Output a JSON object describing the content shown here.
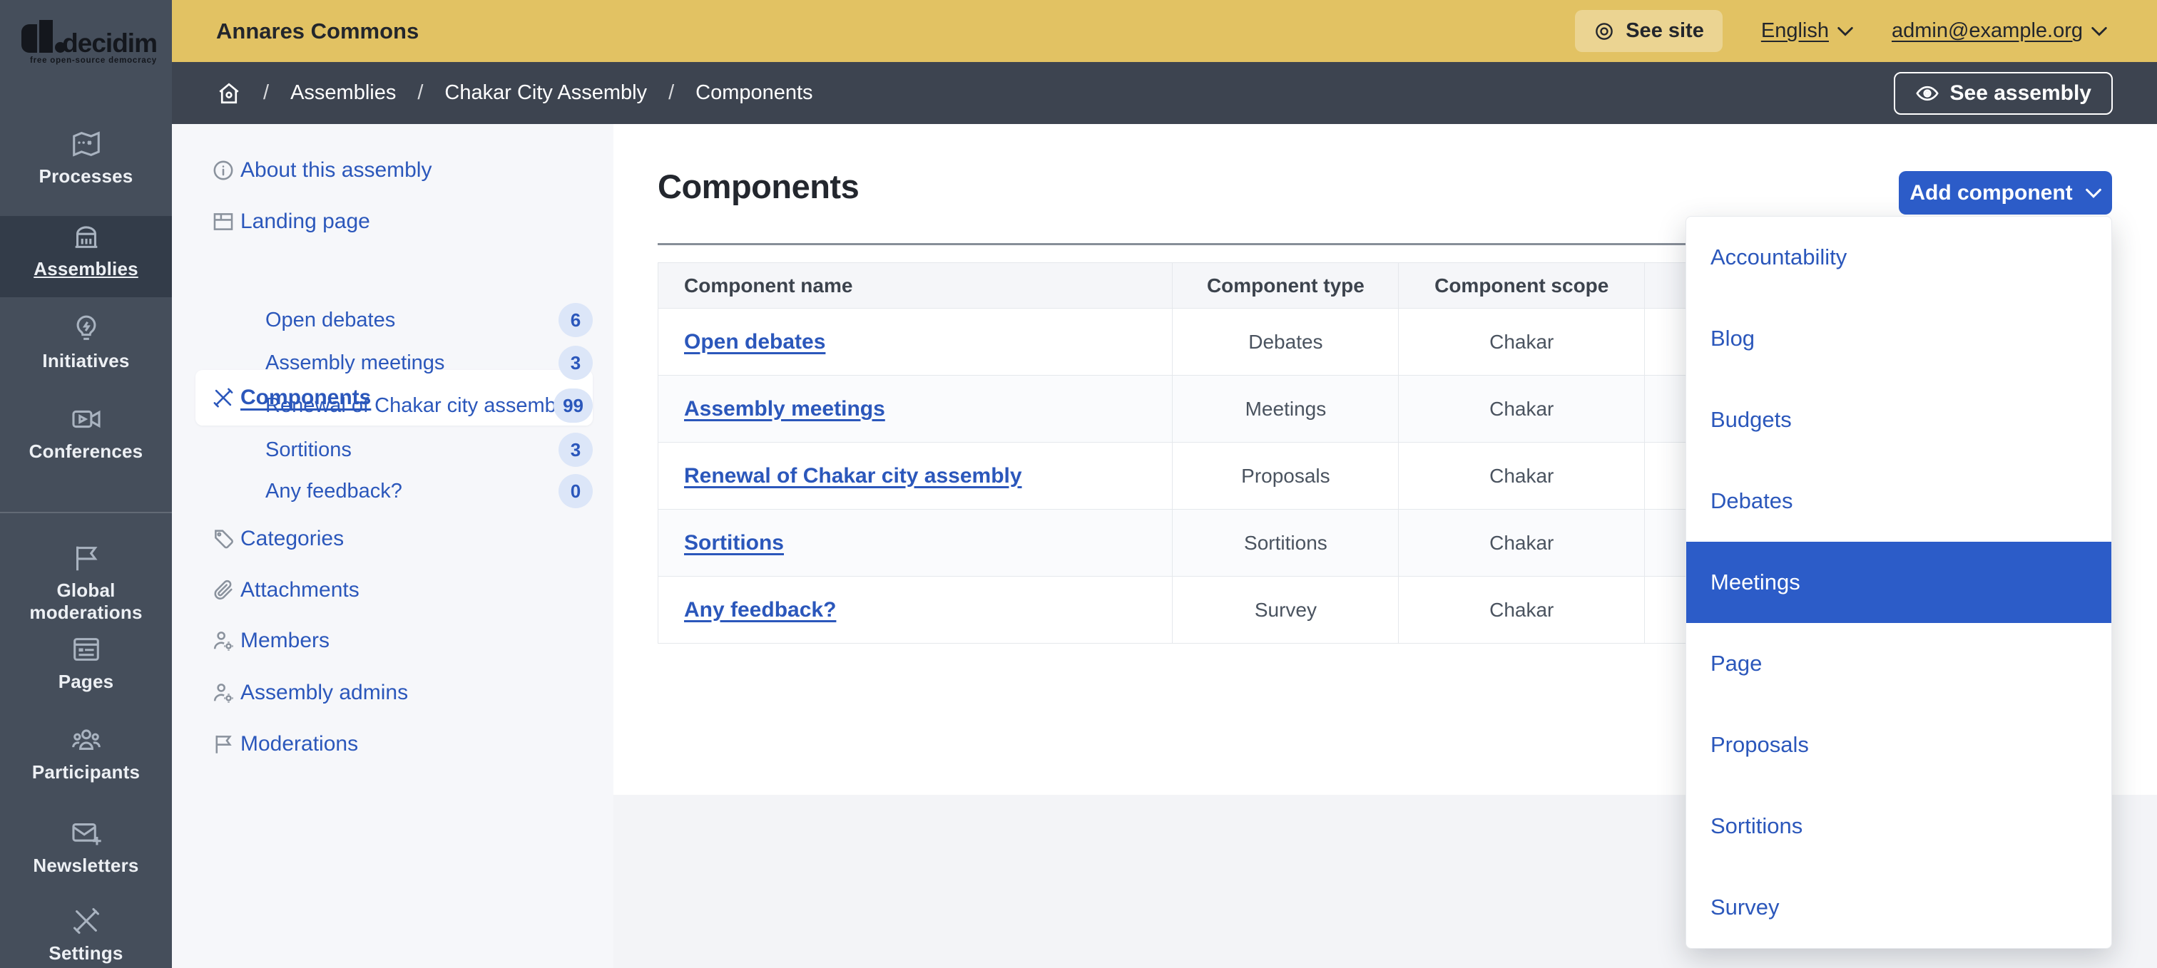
{
  "theme": {
    "colors": {
      "gold": "#e2c263",
      "topbar_text": "#23262c",
      "slate": "#454e5b",
      "slate_dark": "#3d4450",
      "slate_active": "#333c49",
      "sidebar_icon": "#a9b3c0",
      "sidebar_text": "#edf0f4",
      "page_bg": "#f3f4f7",
      "panel_bg": "#f6f7fa",
      "link": "#2b57bb",
      "accent": "#2c5cc8",
      "badge_bg": "#dce6f8",
      "icon_gray": "#8a929d",
      "heading": "#23272e",
      "hr": "#878e98",
      "tborder": "#e5e8ec",
      "header_bg": "#f5f6f9",
      "header_text": "#3c434d",
      "cell_text": "#4a535f",
      "row_alt": "#fafbfd"
    }
  },
  "logo": {
    "name": "decidim",
    "tagline": "free open-source democracy"
  },
  "topbar": {
    "org_name": "Annares Commons",
    "see_site": "See site",
    "language": "English",
    "user_email": "admin@example.org"
  },
  "main_nav": {
    "items": [
      {
        "label": "Processes",
        "icon": "map"
      },
      {
        "label": "Assemblies",
        "icon": "bank",
        "active": true
      },
      {
        "label": "Initiatives",
        "icon": "lightbulb"
      },
      {
        "label": "Conferences",
        "icon": "video-camera"
      },
      {
        "label": "Global moderations",
        "icon": "flag"
      },
      {
        "label": "Pages",
        "icon": "browser"
      },
      {
        "label": "Participants",
        "icon": "people"
      },
      {
        "label": "Newsletters",
        "icon": "mail-plus"
      },
      {
        "label": "Settings",
        "icon": "tools"
      }
    ]
  },
  "breadcrumb": {
    "items": [
      "Assemblies",
      "Chakar City Assembly",
      "Components"
    ],
    "see_assembly": "See assembly"
  },
  "secondary_nav": {
    "items": [
      {
        "label": "About this assembly",
        "icon": "info"
      },
      {
        "label": "Landing page",
        "icon": "layout"
      },
      {
        "label": "Components",
        "icon": "tools",
        "active": true
      }
    ],
    "children": [
      {
        "label": "Open debates",
        "count": "6"
      },
      {
        "label": "Assembly meetings",
        "count": "3"
      },
      {
        "label": "Renewal of Chakar city assembly",
        "count": "99"
      },
      {
        "label": "Sortitions",
        "count": "3"
      },
      {
        "label": "Any feedback?",
        "count": "0"
      }
    ],
    "more": [
      {
        "label": "Categories",
        "icon": "tag"
      },
      {
        "label": "Attachments",
        "icon": "paperclip"
      },
      {
        "label": "Members",
        "icon": "user-gear"
      },
      {
        "label": "Assembly admins",
        "icon": "user-gear"
      },
      {
        "label": "Moderations",
        "icon": "flag"
      }
    ]
  },
  "content": {
    "title": "Components",
    "add_component": "Add component",
    "table": {
      "headers": [
        "Component name",
        "Component type",
        "Component scope"
      ],
      "rows": [
        {
          "name": "Open debates",
          "type": "Debates",
          "scope": "Chakar"
        },
        {
          "name": "Assembly meetings",
          "type": "Meetings",
          "scope": "Chakar"
        },
        {
          "name": "Renewal of Chakar city assembly",
          "type": "Proposals",
          "scope": "Chakar"
        },
        {
          "name": "Sortitions",
          "type": "Sortitions",
          "scope": "Chakar"
        },
        {
          "name": "Any feedback?",
          "type": "Survey",
          "scope": "Chakar"
        }
      ]
    }
  },
  "dropdown": {
    "active": "Meetings",
    "items": [
      {
        "label": "Accountability"
      },
      {
        "label": "Blog"
      },
      {
        "label": "Budgets"
      },
      {
        "label": "Debates"
      },
      {
        "label": "Meetings",
        "active": true
      },
      {
        "label": "Page"
      },
      {
        "label": "Proposals"
      },
      {
        "label": "Sortitions"
      },
      {
        "label": "Survey"
      }
    ]
  }
}
